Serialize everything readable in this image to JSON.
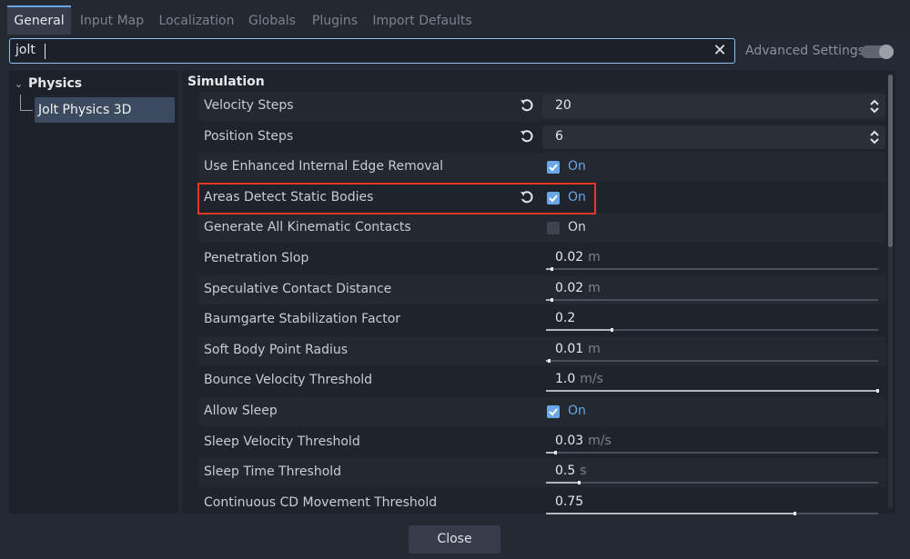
{
  "tabs": [
    {
      "label": "General",
      "active": true
    },
    {
      "label": "Input Map"
    },
    {
      "label": "Localization"
    },
    {
      "label": "Globals"
    },
    {
      "label": "Plugins"
    },
    {
      "label": "Import Defaults"
    }
  ],
  "search": {
    "value": "jolt",
    "clear_icon": "close-icon"
  },
  "advanced_settings": {
    "label": "Advanced Settings",
    "enabled": false
  },
  "tree": {
    "root": "Physics",
    "child": "Jolt Physics 3D"
  },
  "section": {
    "title": "Simulation"
  },
  "rows": [
    {
      "label": "Velocity Steps",
      "type": "spin",
      "value": "20",
      "revert": true
    },
    {
      "label": "Position Steps",
      "type": "spin",
      "value": "6",
      "revert": true
    },
    {
      "label": "Use Enhanced Internal Edge Removal",
      "type": "check",
      "checked": true,
      "text": "On"
    },
    {
      "label": "Areas Detect Static Bodies",
      "type": "check",
      "checked": true,
      "text": "On",
      "revert": true,
      "highlighted": true
    },
    {
      "label": "Generate All Kinematic Contacts",
      "type": "check",
      "checked": false,
      "text": "On"
    },
    {
      "label": "Penetration Slop",
      "type": "slider",
      "value": "0.02",
      "unit": "m",
      "fraction": 0.02
    },
    {
      "label": "Speculative Contact Distance",
      "type": "slider",
      "value": "0.02",
      "unit": "m",
      "fraction": 0.02
    },
    {
      "label": "Baumgarte Stabilization Factor",
      "type": "slider",
      "value": "0.2",
      "unit": "",
      "fraction": 0.2
    },
    {
      "label": "Soft Body Point Radius",
      "type": "slider",
      "value": "0.01",
      "unit": "m",
      "fraction": 0.01
    },
    {
      "label": "Bounce Velocity Threshold",
      "type": "slider",
      "value": "1.0",
      "unit": "m/s",
      "fraction": 1.0
    },
    {
      "label": "Allow Sleep",
      "type": "check",
      "checked": true,
      "text": "On"
    },
    {
      "label": "Sleep Velocity Threshold",
      "type": "slider",
      "value": "0.03",
      "unit": "m/s",
      "fraction": 0.03
    },
    {
      "label": "Sleep Time Threshold",
      "type": "slider",
      "value": "0.5",
      "unit": "s",
      "fraction": 0.1
    },
    {
      "label": "Continuous CD Movement Threshold",
      "type": "slider",
      "value": "0.75",
      "unit": "",
      "fraction": 0.75
    }
  ],
  "footer": {
    "close_label": "Close"
  },
  "colors": {
    "accent": "#6aa7e6",
    "highlight": "#e23a22"
  }
}
